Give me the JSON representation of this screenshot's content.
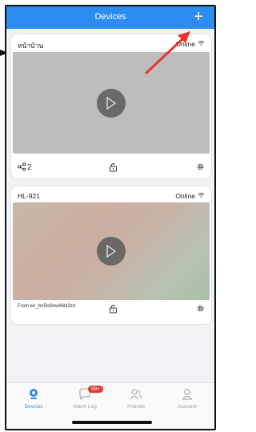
{
  "header": {
    "title": "Devices",
    "add_label": "+"
  },
  "devices": [
    {
      "name": "หน้าบ้าน",
      "status": "Online",
      "share_count": "2",
      "preview_color": "#bdbdbd"
    },
    {
      "name": "HL-921",
      "status": "Online",
      "shared_from": "From:eir_bn5tc8nw86l43z4",
      "preview_color": "#c7b2a7"
    }
  ],
  "tabs": [
    {
      "label": "Devices",
      "icon": "devices-icon",
      "active": true
    },
    {
      "label": "Alarm Log",
      "icon": "alarm-log-icon",
      "badge": "99+"
    },
    {
      "label": "Friends",
      "icon": "friends-icon"
    },
    {
      "label": "Account",
      "icon": "account-icon"
    }
  ],
  "colors": {
    "accent": "#2d8cf0",
    "badge": "#e8352e",
    "annotation_arrow": "#e8352e"
  }
}
